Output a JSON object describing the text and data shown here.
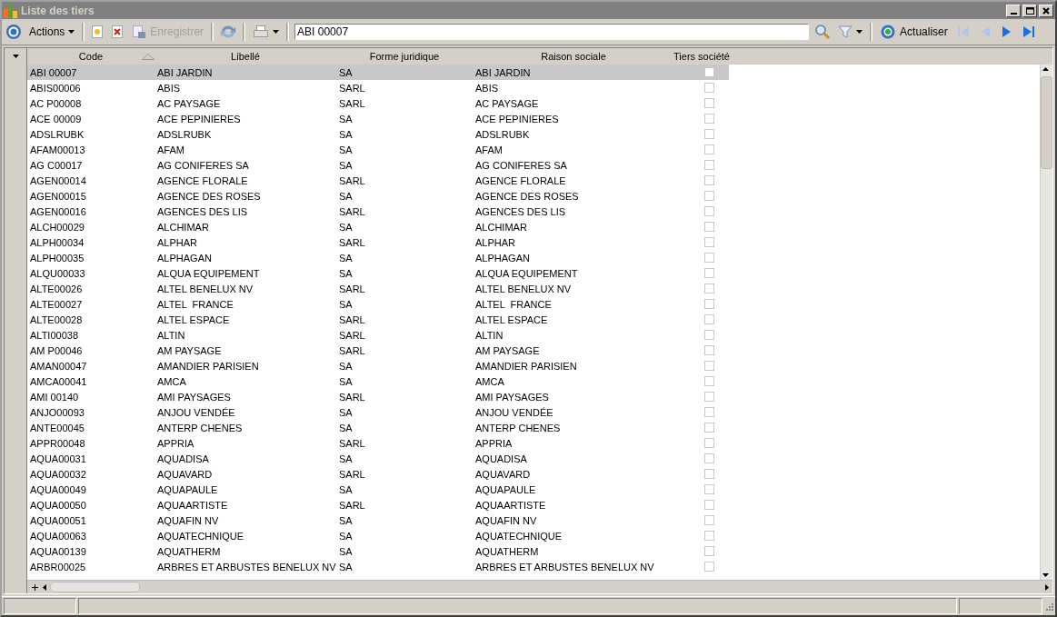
{
  "window": {
    "title": "Liste des tiers"
  },
  "toolbar": {
    "actions_menu": "Actions",
    "save_button": {
      "label": "Enregistrer",
      "disabled": true
    },
    "search": {
      "value": "ABI 00007"
    },
    "refresh_button": "Actualiser",
    "navigation": [
      {
        "disabled": true
      },
      {
        "disabled": true
      },
      {
        "disabled": false
      },
      {
        "disabled": false
      }
    ]
  },
  "grid": {
    "columns": [
      {
        "label": "Code",
        "sorted": true
      },
      {
        "label": "Libellé",
        "sorted": false
      },
      {
        "label": "Forme juridique",
        "sorted": false
      },
      {
        "label": "Raison sociale",
        "sorted": false
      },
      {
        "label": "Tiers société",
        "sorted": false
      }
    ],
    "rows": [
      {
        "code": "ABI 00007",
        "libelle": "ABI JARDIN",
        "forme": "SA",
        "raison": "ABI JARDIN",
        "tiers_societe": false,
        "selected": true
      },
      {
        "code": "ABIS00006",
        "libelle": "ABIS",
        "forme": "SARL",
        "raison": "ABIS",
        "tiers_societe": false,
        "selected": false
      },
      {
        "code": "AC P00008",
        "libelle": "AC PAYSAGE",
        "forme": "SARL",
        "raison": "AC PAYSAGE",
        "tiers_societe": false,
        "selected": false
      },
      {
        "code": "ACE 00009",
        "libelle": "ACE PEPINIERES",
        "forme": "SA",
        "raison": "ACE PEPINIERES",
        "tiers_societe": false,
        "selected": false
      },
      {
        "code": "ADSLRUBK",
        "libelle": "ADSLRUBK",
        "forme": "SA",
        "raison": "ADSLRUBK",
        "tiers_societe": false,
        "selected": false
      },
      {
        "code": "AFAM00013",
        "libelle": "AFAM",
        "forme": "SA",
        "raison": "AFAM",
        "tiers_societe": false,
        "selected": false
      },
      {
        "code": "AG C00017",
        "libelle": "AG CONIFERES SA",
        "forme": "SA",
        "raison": "AG CONIFERES SA",
        "tiers_societe": false,
        "selected": false
      },
      {
        "code": "AGEN00014",
        "libelle": "AGENCE FLORALE",
        "forme": "SARL",
        "raison": "AGENCE FLORALE",
        "tiers_societe": false,
        "selected": false
      },
      {
        "code": "AGEN00015",
        "libelle": "AGENCE DES ROSES",
        "forme": "SA",
        "raison": "AGENCE DES ROSES",
        "tiers_societe": false,
        "selected": false
      },
      {
        "code": "AGEN00016",
        "libelle": "AGENCES DES LIS",
        "forme": "SARL",
        "raison": "AGENCES DES LIS",
        "tiers_societe": false,
        "selected": false
      },
      {
        "code": "ALCH00029",
        "libelle": "ALCHIMAR",
        "forme": "SA",
        "raison": "ALCHIMAR",
        "tiers_societe": false,
        "selected": false
      },
      {
        "code": "ALPH00034",
        "libelle": "ALPHAR",
        "forme": "SARL",
        "raison": "ALPHAR",
        "tiers_societe": false,
        "selected": false
      },
      {
        "code": "ALPH00035",
        "libelle": "ALPHAGAN",
        "forme": "SA",
        "raison": "ALPHAGAN",
        "tiers_societe": false,
        "selected": false
      },
      {
        "code": "ALQU00033",
        "libelle": "ALQUA EQUIPEMENT",
        "forme": "SA",
        "raison": "ALQUA EQUIPEMENT",
        "tiers_societe": false,
        "selected": false
      },
      {
        "code": "ALTE00026",
        "libelle": "ALTEL BENELUX NV",
        "forme": "SARL",
        "raison": "ALTEL BENELUX NV",
        "tiers_societe": false,
        "selected": false
      },
      {
        "code": "ALTE00027",
        "libelle": "ALTEL  FRANCE",
        "forme": "SA",
        "raison": "ALTEL  FRANCE",
        "tiers_societe": false,
        "selected": false
      },
      {
        "code": "ALTE00028",
        "libelle": "ALTEL ESPACE",
        "forme": "SARL",
        "raison": "ALTEL ESPACE",
        "tiers_societe": false,
        "selected": false
      },
      {
        "code": "ALTI00038",
        "libelle": "ALTIN",
        "forme": "SARL",
        "raison": "ALTIN",
        "tiers_societe": false,
        "selected": false
      },
      {
        "code": "AM P00046",
        "libelle": "AM PAYSAGE",
        "forme": "SARL",
        "raison": "AM PAYSAGE",
        "tiers_societe": false,
        "selected": false
      },
      {
        "code": "AMAN00047",
        "libelle": "AMANDIER PARISIEN",
        "forme": "SA",
        "raison": "AMANDIER PARISIEN",
        "tiers_societe": false,
        "selected": false
      },
      {
        "code": "AMCA00041",
        "libelle": "AMCA",
        "forme": "SA",
        "raison": "AMCA",
        "tiers_societe": false,
        "selected": false
      },
      {
        "code": "AMI 00140",
        "libelle": "AMI PAYSAGES",
        "forme": "SARL",
        "raison": "AMI PAYSAGES",
        "tiers_societe": false,
        "selected": false
      },
      {
        "code": "ANJO00093",
        "libelle": "ANJOU VENDÉE",
        "forme": "SA",
        "raison": "ANJOU VENDÉE",
        "tiers_societe": false,
        "selected": false
      },
      {
        "code": "ANTE00045",
        "libelle": "ANTERP CHENES",
        "forme": "SA",
        "raison": "ANTERP CHENES",
        "tiers_societe": false,
        "selected": false
      },
      {
        "code": "APPR00048",
        "libelle": "APPRIA",
        "forme": "SARL",
        "raison": "APPRIA",
        "tiers_societe": false,
        "selected": false
      },
      {
        "code": "AQUA00031",
        "libelle": "AQUADISA",
        "forme": "SA",
        "raison": "AQUADISA",
        "tiers_societe": false,
        "selected": false
      },
      {
        "code": "AQUA00032",
        "libelle": "AQUAVARD",
        "forme": "SARL",
        "raison": "AQUAVARD",
        "tiers_societe": false,
        "selected": false
      },
      {
        "code": "AQUA00049",
        "libelle": "AQUAPAULE",
        "forme": "SA",
        "raison": "AQUAPAULE",
        "tiers_societe": false,
        "selected": false
      },
      {
        "code": "AQUA00050",
        "libelle": "AQUAARTISTE",
        "forme": "SARL",
        "raison": "AQUAARTISTE",
        "tiers_societe": false,
        "selected": false
      },
      {
        "code": "AQUA00051",
        "libelle": "AQUAFIN NV",
        "forme": "SA",
        "raison": "AQUAFIN NV",
        "tiers_societe": false,
        "selected": false
      },
      {
        "code": "AQUA00063",
        "libelle": "AQUATECHNIQUE",
        "forme": "SA",
        "raison": "AQUATECHNIQUE",
        "tiers_societe": false,
        "selected": false
      },
      {
        "code": "AQUA00139",
        "libelle": "AQUATHERM",
        "forme": "SA",
        "raison": "AQUATHERM",
        "tiers_societe": false,
        "selected": false
      },
      {
        "code": "ARBR00025",
        "libelle": "ARBRES ET ARBUSTES BENELUX NV",
        "forme": "SA",
        "raison": "ARBRES ET ARBUSTES BENELUX NV",
        "tiers_societe": false,
        "selected": false
      }
    ]
  }
}
